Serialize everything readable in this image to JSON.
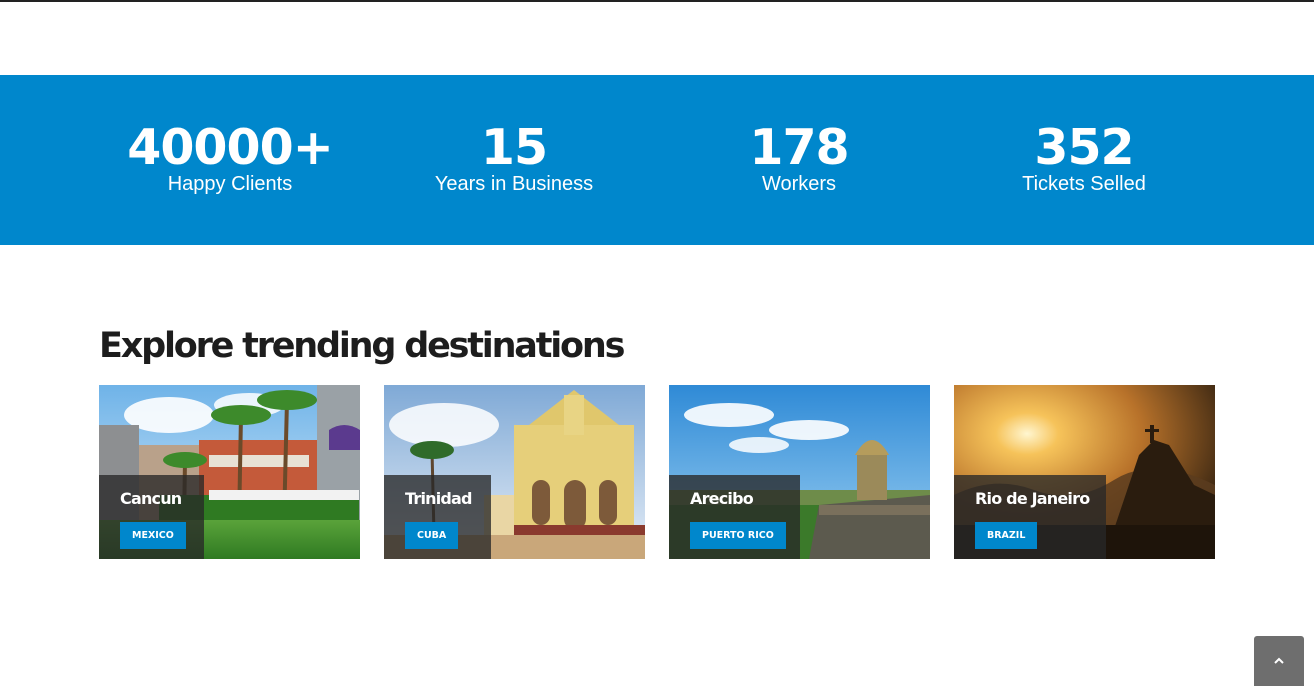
{
  "stats": [
    {
      "number": "40000+",
      "label": "Happy Clients"
    },
    {
      "number": "15",
      "label": "Years in Business"
    },
    {
      "number": "178",
      "label": "Workers"
    },
    {
      "number": "352",
      "label": "Tickets Selled"
    }
  ],
  "destinations_section": {
    "title": "Explore trending destinations",
    "cards": [
      {
        "name": "Cancun",
        "country": "MEXICO"
      },
      {
        "name": "Trinidad",
        "country": "CUBA"
      },
      {
        "name": "Arecibo",
        "country": "PUERTO RICO"
      },
      {
        "name": "Rio de Janeiro",
        "country": "BRAZIL"
      }
    ]
  },
  "colors": {
    "accent": "#0087cc",
    "heading": "#1d1d1d",
    "back_to_top_bg": "#6e6e6e"
  },
  "icons": {
    "back_to_top": "chevron-up-icon"
  }
}
